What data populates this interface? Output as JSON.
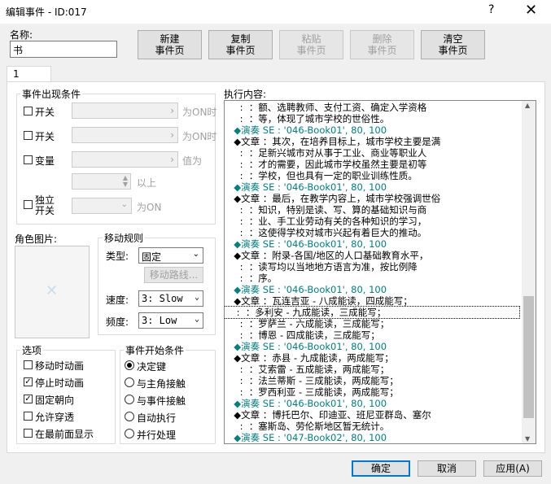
{
  "window": {
    "title": "编辑事件 - ID:017",
    "help": "?",
    "close": "✕"
  },
  "name_label": "名称:",
  "name_value": "书",
  "buttons": {
    "new_page": [
      "新建",
      "事件页"
    ],
    "copy_page": [
      "复制",
      "事件页"
    ],
    "paste_page": [
      "粘贴",
      "事件页"
    ],
    "delete_page": [
      "删除",
      "事件页"
    ],
    "clear_page": [
      "清空",
      "事件页"
    ],
    "ok": "确定",
    "cancel": "取消",
    "apply": "应用(A)"
  },
  "tab": "1",
  "conditions": {
    "title": "事件出现条件",
    "switch1": "开关",
    "switch2": "开关",
    "variable": "变量",
    "self_switch": [
      "独立",
      "开关"
    ],
    "on1": "为ON时",
    "on2": "为ON时",
    "value_is": "值为",
    "above": "以上",
    "is_on": "为ON"
  },
  "image": {
    "title": "角色图片:"
  },
  "movement": {
    "title": "移动规则",
    "type_label": "类型:",
    "type_value": "固定",
    "route_button": "移动路线...",
    "speed_label": "速度:",
    "speed_value": "3: Slow",
    "freq_label": "频度:",
    "freq_value": "3: Low"
  },
  "options": {
    "title": "选项",
    "items": [
      {
        "label": "移动时动画",
        "checked": false
      },
      {
        "label": "停止时动画",
        "checked": true
      },
      {
        "label": "固定朝向",
        "checked": true
      },
      {
        "label": "允许穿透",
        "checked": false
      },
      {
        "label": "在最前面显示",
        "checked": false
      }
    ]
  },
  "trigger": {
    "title": "事件开始条件",
    "items": [
      {
        "label": "决定键",
        "selected": true
      },
      {
        "label": "与主角接触",
        "selected": false
      },
      {
        "label": "与事件接触",
        "selected": false
      },
      {
        "label": "自动执行",
        "selected": false
      },
      {
        "label": "并行处理",
        "selected": false
      }
    ]
  },
  "content": {
    "title": "执行内容:",
    "lines": [
      {
        "text": "    :  ：额、选聘教师、支付工资、确定入学资格",
        "color": "black"
      },
      {
        "text": "    :  ：等，体现了城市学校的世俗性。",
        "color": "black"
      },
      {
        "text": "  ◆演奏 SE : '046-Book01', 80, 100",
        "color": "green"
      },
      {
        "text": "  ◆文章 ：其次，在培养目标上，城市学校主要是满",
        "color": "black"
      },
      {
        "text": "    :  ：足新兴城市对从事于工业、商业等职业人",
        "color": "black"
      },
      {
        "text": "    :  ：才的需要，因此城市学校虽然主要是初等",
        "color": "black"
      },
      {
        "text": "    :  ：学校，但也具有一定的职业训练性质。",
        "color": "black"
      },
      {
        "text": "  ◆演奏 SE : '046-Book01', 80, 100",
        "color": "green"
      },
      {
        "text": "  ◆文章 ：最后，在教学内容上，城市学校强调世俗",
        "color": "black"
      },
      {
        "text": "    :  ：知识，特别是读、写、算的基础知识与商",
        "color": "black"
      },
      {
        "text": "    :  ：业、手工业劳动有关的各种知识的学习，",
        "color": "black"
      },
      {
        "text": "    :  ：这使得学校对城市兴起有着巨大的推动。",
        "color": "black"
      },
      {
        "text": "  ◆演奏 SE : '046-Book01', 80, 100",
        "color": "green"
      },
      {
        "text": "  ◆文章 ：附录-各国/地区的人口基础教育水平，",
        "color": "black"
      },
      {
        "text": "    :  ：读写均以当地地方语言为准，按比例降",
        "color": "black"
      },
      {
        "text": "    :  ：序。",
        "color": "black"
      },
      {
        "text": "  ◆演奏 SE : '046-Book01', 80, 100",
        "color": "green"
      },
      {
        "text": "  ◆文章 ：瓦连吉亚 - 八成能读，四成能写；",
        "color": "black"
      },
      {
        "text": "    :  ：多利安 - 九成能读，三成能写；",
        "color": "black",
        "selected": true
      },
      {
        "text": "    :  ：罗萨兰 - 六成能读，三成能写；",
        "color": "black"
      },
      {
        "text": "    :  ：博恩 - 四成能读，三成能写；",
        "color": "black"
      },
      {
        "text": "  ◆演奏 SE : '046-Book01', 80, 100",
        "color": "green"
      },
      {
        "text": "  ◆文章 ：赤县 - 九成能读，两成能写；",
        "color": "black"
      },
      {
        "text": "    :  ：艾索雷 - 五成能读，两成能写；",
        "color": "black"
      },
      {
        "text": "    :  ：法兰蒂斯 - 三成能读，两成能写；",
        "color": "black"
      },
      {
        "text": "    :  ：罗西利亚 - 三成能读，两成能写；",
        "color": "black"
      },
      {
        "text": "  ◆演奏 SE : '046-Book01', 80, 100",
        "color": "green"
      },
      {
        "text": "  ◆文章 ：博托巴尔、印迪亚、班尼亚群岛、塞尔",
        "color": "black"
      },
      {
        "text": "    :  ：塞斯岛、劳伦斯地区暂无统计。",
        "color": "black"
      },
      {
        "text": "  ◆演奏 SE : '047-Book02', 80, 100",
        "color": "green"
      }
    ]
  }
}
